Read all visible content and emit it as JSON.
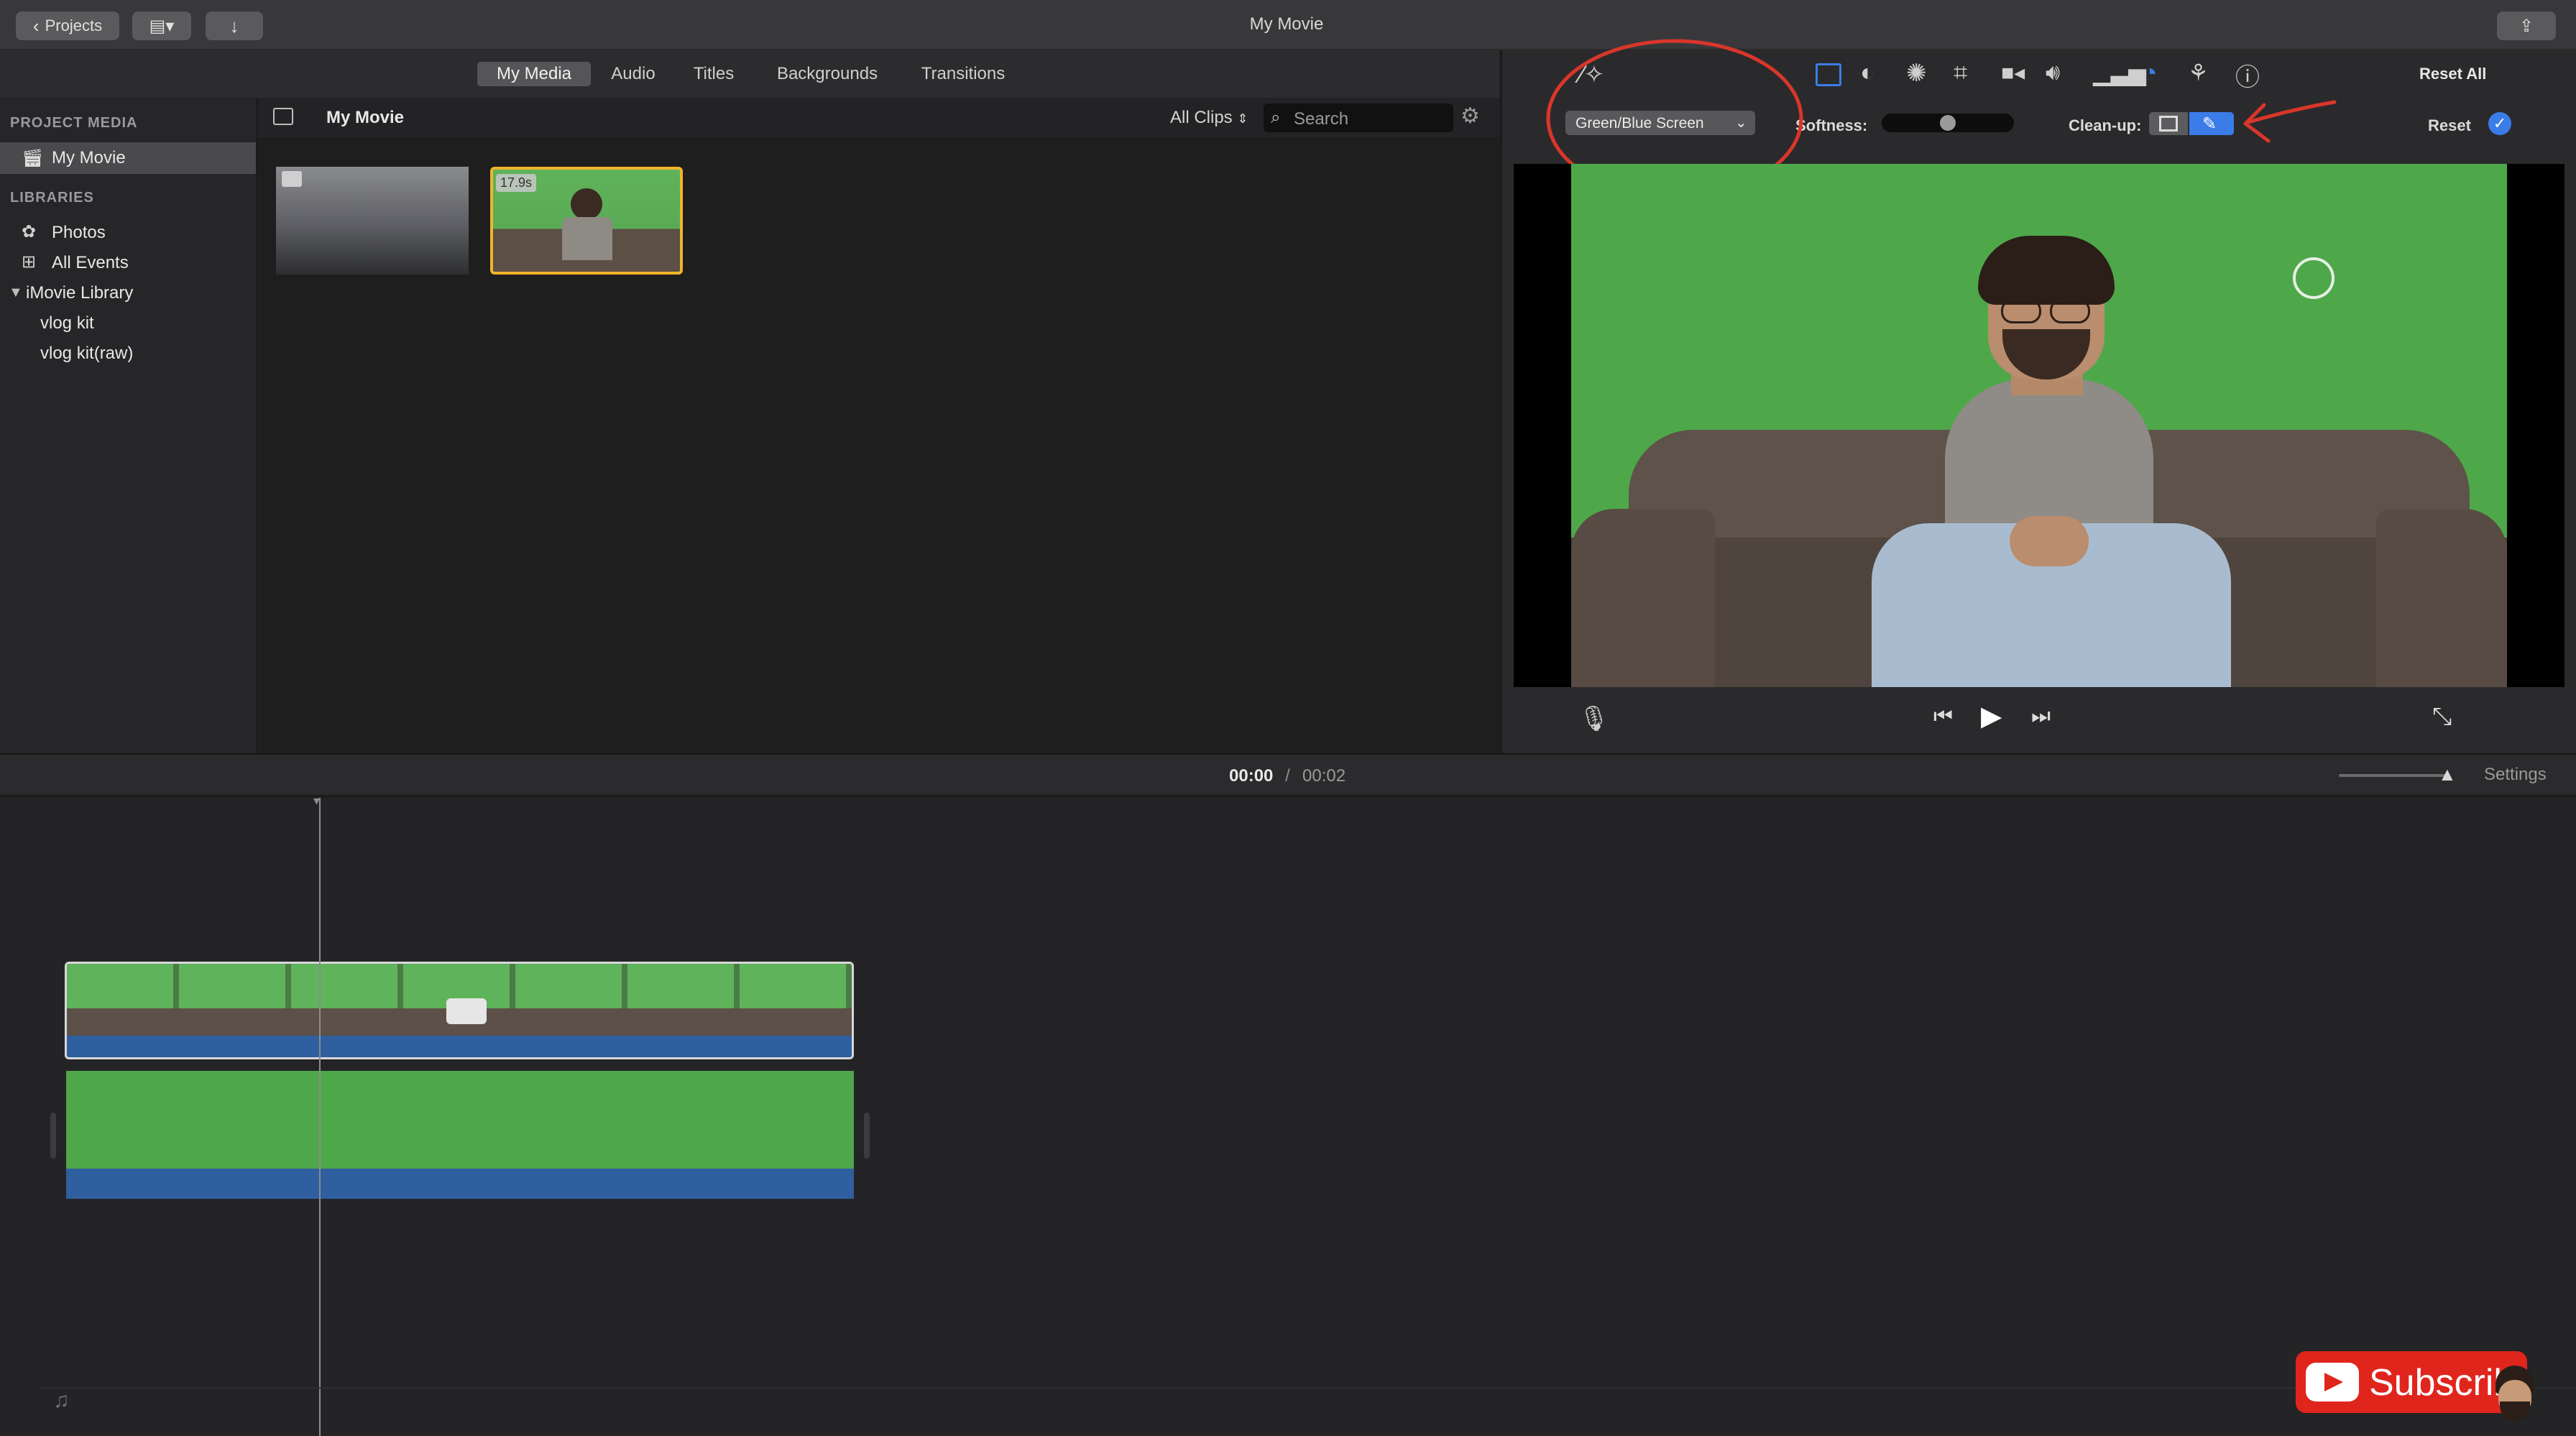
{
  "window": {
    "title": "My Movie",
    "projects_label": "Projects"
  },
  "tabs": [
    {
      "label": "My Media",
      "active": true
    },
    {
      "label": "Audio"
    },
    {
      "label": "Titles"
    },
    {
      "label": "Backgrounds"
    },
    {
      "label": "Transitions"
    }
  ],
  "sidebar": {
    "project_media_heading": "PROJECT MEDIA",
    "project_item": "My Movie",
    "libraries_heading": "LIBRARIES",
    "photos": "Photos",
    "all_events": "All Events",
    "library": "iMovie Library",
    "events": [
      "vlog kit",
      "vlog kit(raw)"
    ]
  },
  "browser": {
    "title": "My Movie",
    "filter": "All Clips",
    "search_placeholder": "Search",
    "clip_duration": "17.9s"
  },
  "viewer": {
    "overlay_mode": "Green/Blue Screen",
    "softness_label": "Softness:",
    "softness_value": 0.5,
    "cleanup_label": "Clean-up:",
    "reset_all": "Reset All",
    "reset": "Reset"
  },
  "timeline": {
    "current_time": "00:00",
    "separator": "/",
    "total_time": "00:02",
    "settings": "Settings"
  },
  "overlay": {
    "subscribe": "Subscrib"
  },
  "colors": {
    "accent": "#3b7de8",
    "annotation": "#d9362b",
    "green_screen": "#4ea84a",
    "audio_blue": "#2f5f9e"
  }
}
